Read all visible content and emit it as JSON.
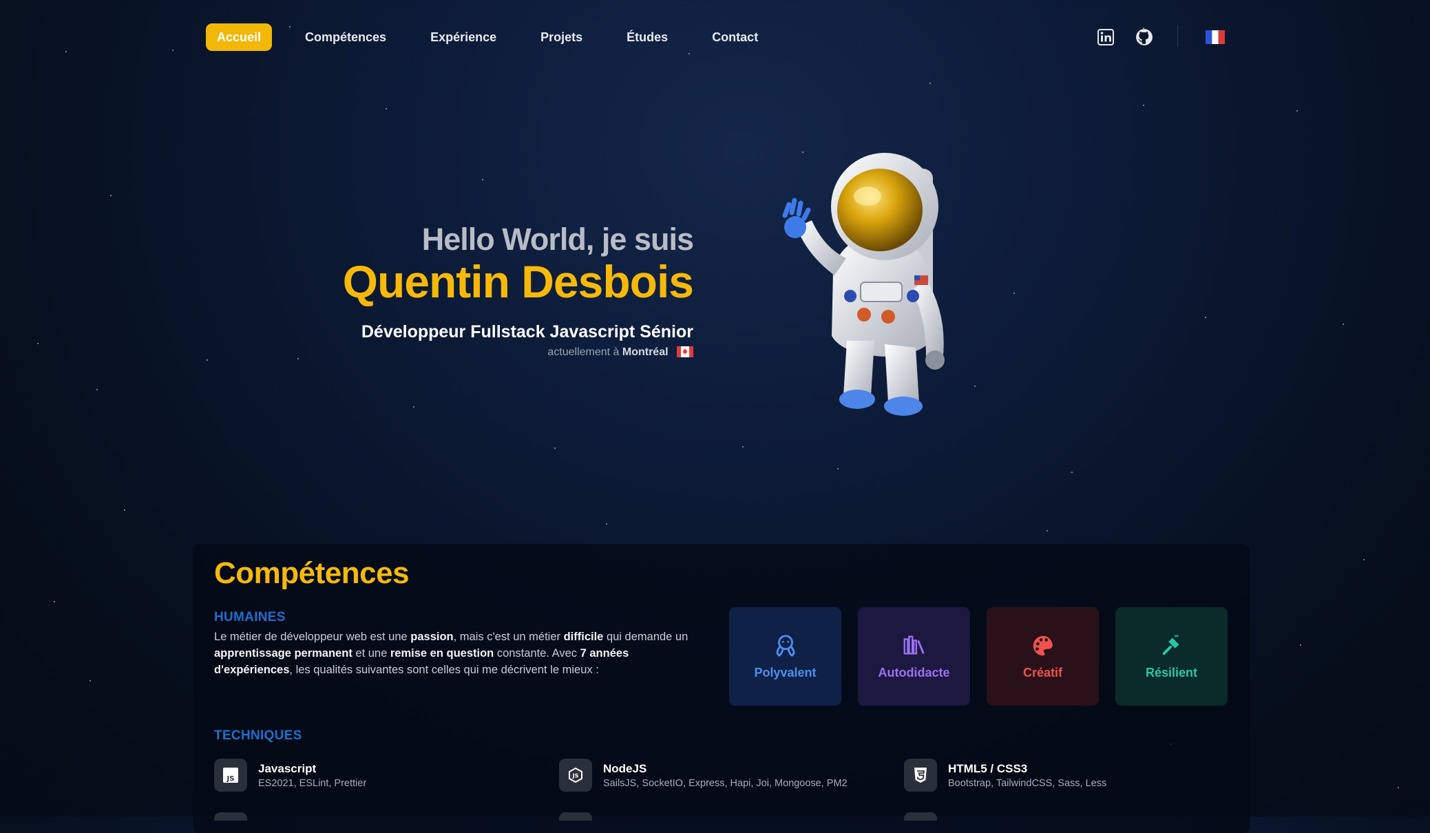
{
  "nav": {
    "items": [
      {
        "label": "Accueil",
        "active": true
      },
      {
        "label": "Compétences"
      },
      {
        "label": "Expérience"
      },
      {
        "label": "Projets"
      },
      {
        "label": "Études"
      },
      {
        "label": "Contact"
      }
    ],
    "icons": [
      "linkedin-icon",
      "github-icon",
      "flag-fr-icon"
    ]
  },
  "hero": {
    "greeting": "Hello World, je suis",
    "name": "Quentin Desbois",
    "role": "Développeur Fullstack Javascript Sénior",
    "location_prefix": "actuellement à",
    "location_city": "Montréal",
    "location_flag": "flag-ca-icon"
  },
  "competences": {
    "title": "Compétences",
    "humaines_title": "HUMAINES",
    "para": {
      "p1": "Le métier de développeur web est une ",
      "b1": "passion",
      "p2": ", mais c'est un métier ",
      "b2": "difficile",
      "p3": " qui demande un ",
      "b3": "apprentissage permanent",
      "p4": " et une ",
      "b4": "remise en question",
      "p5": " constante. Avec ",
      "b5": "7 années d'expériences",
      "p6": ", les qualités suivantes sont celles qui me décrivent le mieux :"
    },
    "qualities": [
      {
        "label": "Polyvalent",
        "color": "#4f8ef0",
        "bg": "#0f2146",
        "icon": "octopus-icon"
      },
      {
        "label": "Autodidacte",
        "color": "#9a72f2",
        "bg": "#1c1840",
        "icon": "books-icon"
      },
      {
        "label": "Créatif",
        "color": "#f0524e",
        "bg": "#2a1119",
        "icon": "palette-icon"
      },
      {
        "label": "Résilient",
        "color": "#28c7a8",
        "bg": "#0b2a2a",
        "icon": "hammer-icon"
      }
    ],
    "techniques_title": "TECHNIQUES",
    "techniques": [
      {
        "name": "Javascript",
        "details": "ES2021, ESLint, Prettier",
        "icon": "js-icon"
      },
      {
        "name": "NodeJS",
        "details": "SailsJS, SocketIO, Express, Hapi, Joi, Mongoose, PM2",
        "icon": "nodejs-icon"
      },
      {
        "name": "HTML5 / CSS3",
        "details": "Bootstrap, TailwindCSS, Sass, Less",
        "icon": "html5-icon"
      }
    ]
  },
  "colors": {
    "accent": "#f6b90a",
    "section_subtitle": "#1f6fd1"
  }
}
